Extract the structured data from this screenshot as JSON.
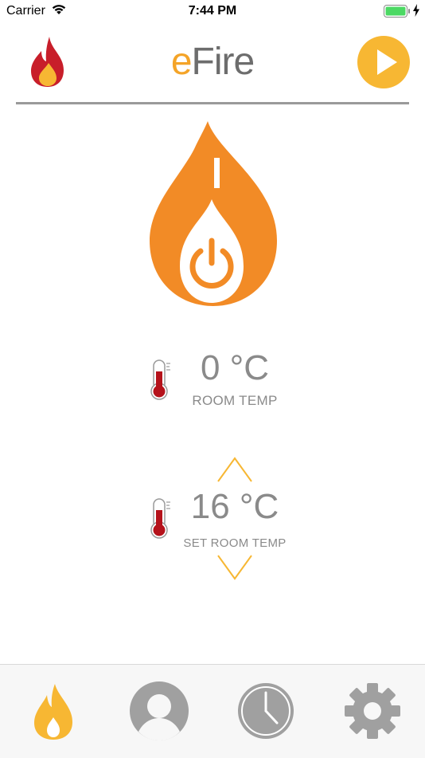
{
  "status_bar": {
    "carrier": "Carrier",
    "time": "7:44 PM",
    "icons": [
      "wifi-icon",
      "battery-icon",
      "charging-icon"
    ]
  },
  "header": {
    "brand_e": "e",
    "brand_rest": "Fire",
    "icons": [
      "flame-logo-icon",
      "play-icon"
    ]
  },
  "main": {
    "power_icon": "power-icon",
    "room_temp": {
      "value": "0  °C",
      "label": "ROOM TEMP"
    },
    "set_room_temp": {
      "value": "16 °C",
      "label": "SET ROOM TEMP"
    }
  },
  "tab_bar": {
    "tabs": [
      {
        "icon": "flame-icon",
        "active": true
      },
      {
        "icon": "user-icon",
        "active": false
      },
      {
        "icon": "clock-icon",
        "active": false
      },
      {
        "icon": "gear-icon",
        "active": false
      }
    ]
  },
  "colors": {
    "accent_orange": "#F28B26",
    "accent_yellow": "#F7B733",
    "thermo_red": "#B5121B",
    "text_gray": "#8a8a8a",
    "tab_gray": "#a0a0a0"
  }
}
